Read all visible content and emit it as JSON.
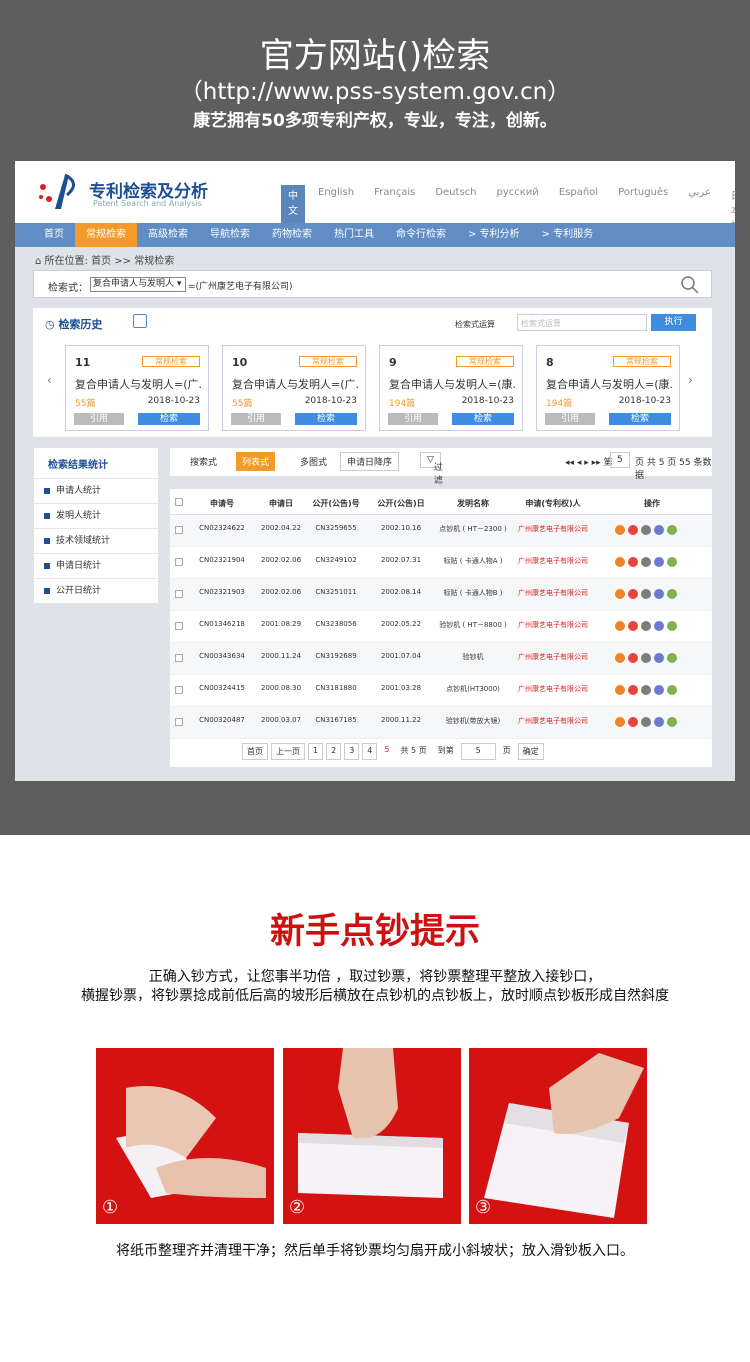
{
  "banner": {
    "title": "官方网站()检索",
    "url": "（http://www.pss-system.gov.cn）",
    "slogan": "康艺拥有50多项专利产权，专业，专注，创新。"
  },
  "site": {
    "title": "专利检索及分析",
    "subtitle": "Patent Search and Analysis",
    "langs": [
      "中文",
      "English",
      "Français",
      "Deutsch",
      "русский",
      "Español",
      "Português",
      "عربي",
      "日本語"
    ],
    "nav": [
      "首页",
      "常规检索",
      "高级检索",
      "导航检索",
      "药物检索",
      "热门工具",
      "命令行检索",
      "> 专利分析",
      "> 专利服务"
    ],
    "breadcrumb": "所在位置: 首页 >> 常规检索",
    "search": {
      "label": "检索式：",
      "select": "复合申请人与发明人",
      "value": "=(广州康艺电子有限公司)"
    },
    "history": {
      "title": "检索历史",
      "expr_label": "检索式运算",
      "expr_placeholder": "检索式运算",
      "exec": "执行",
      "cards": [
        {
          "num": "11",
          "tag": "常规检索",
          "query": "复合申请人与发明人=(广...",
          "count": "55篇",
          "date": "2018-10-23",
          "cite": "引用",
          "search": "检索"
        },
        {
          "num": "10",
          "tag": "常规检索",
          "query": "复合申请人与发明人=(广...",
          "count": "55篇",
          "date": "2018-10-23",
          "cite": "引用",
          "search": "检索"
        },
        {
          "num": "9",
          "tag": "常规检索",
          "query": "复合申请人与发明人=(康...",
          "count": "194篇",
          "date": "2018-10-23",
          "cite": "引用",
          "search": "检索"
        },
        {
          "num": "8",
          "tag": "常规检索",
          "query": "复合申请人与发明人=(康...",
          "count": "194篇",
          "date": "2018-10-23",
          "cite": "引用",
          "search": "检索"
        }
      ]
    },
    "stats": {
      "title": "检索结果统计",
      "items": [
        "申请人统计",
        "发明人统计",
        "技术领域统计",
        "申请日统计",
        "公开日统计"
      ]
    },
    "toolbar": {
      "t1": "搜索式",
      "t2": "列表式",
      "t3": "多图式",
      "sort": "申请日降序",
      "filter": "过滤",
      "page": "5",
      "total": "页 共 5 页 55 条数据"
    },
    "table": {
      "headers": [
        "申请号",
        "申请日",
        "公开(公告)号",
        "公开(公告)日",
        "发明名称",
        "申请(专利权)人",
        "操作"
      ],
      "rows": [
        [
          "CN02324622",
          "2002.04.22",
          "CN3259655",
          "2002.10.16",
          "点钞机 ( HT－2300 )",
          "广州康艺电子有限公司"
        ],
        [
          "CN02321904",
          "2002.02.06",
          "CN3249102",
          "2002.07.31",
          "标贴 ( 卡通人物A )",
          "广州康艺电子有限公司"
        ],
        [
          "CN02321903",
          "2002.02.06",
          "CN3251011",
          "2002.08.14",
          "标贴 ( 卡通人物B )",
          "广州康艺电子有限公司"
        ],
        [
          "CN01346218",
          "2001.08.29",
          "CN3238056",
          "2002.05.22",
          "验钞机 ( HT－8800 )",
          "广州康艺电子有限公司"
        ],
        [
          "CN00343634",
          "2000.11.24",
          "CN3192689",
          "2001.07.04",
          "验钞机",
          "广州康艺电子有限公司"
        ],
        [
          "CN00324415",
          "2000.08.30",
          "CN3181880",
          "2001.03.28",
          "点钞机(HT3000)",
          "广州康艺电子有限公司"
        ],
        [
          "CN00320487",
          "2000.03.07",
          "CN3167185",
          "2000.11.22",
          "验钞机(带放大镜)",
          "广州康艺电子有限公司"
        ]
      ]
    },
    "pager": {
      "first": "首页",
      "prev": "上一页",
      "pages": [
        "1",
        "2",
        "3",
        "4",
        "5"
      ],
      "total": "共 5 页",
      "goto": "到第",
      "input": "5",
      "unit": "页",
      "ok": "确定"
    }
  },
  "tips": {
    "title": "新手点钞提示",
    "line1": "正确入钞方式，让您事半功倍 ，取过钞票，将钞票整理平整放入接钞口，",
    "line2": "横握钞票，将钞票捻成前低后高的坡形后横放在点钞机的点钞板上，放时顺点钞板形成自然斜度",
    "steps": [
      "①",
      "②",
      "③"
    ],
    "caption": "将纸币整理齐并清理干净；然后单手将钞票均匀扇开成小斜坡状；放入滑钞板入口。"
  }
}
